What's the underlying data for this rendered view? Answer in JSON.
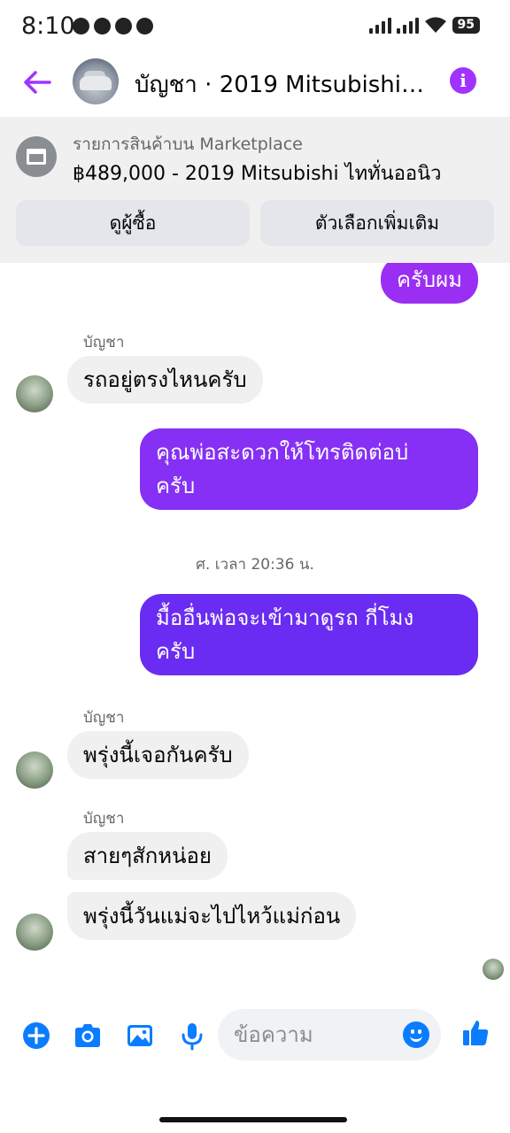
{
  "status_bar": {
    "time": "8:10",
    "battery": "95"
  },
  "header": {
    "title": "บัญชา · 2019 Mitsubishi…"
  },
  "marketplace": {
    "subtitle": "รายการสินค้าบน Marketplace",
    "listing": "฿489,000 - 2019 Mitsubishi ไททั่นออนิว",
    "view_buyer": "ดูผู้ซื้อ",
    "more_options": "ตัวเลือกเพิ่มเติม"
  },
  "messages": [
    {
      "direction": "out",
      "text": "ครับผม"
    },
    {
      "direction": "in",
      "sender": "บัญชา",
      "text": "รถอยู่ตรงไหนครับ"
    },
    {
      "direction": "out",
      "text": "คุณพ่อสะดวกให้โทรติดต่อบ่\nครับ"
    },
    {
      "type": "timestamp",
      "text": "ศ. เวลา 20:36 น."
    },
    {
      "direction": "out",
      "text": "มื้ออื่นพ่อจะเข้ามาดูรถ กี่โมง\nครับ"
    },
    {
      "direction": "in",
      "sender": "บัญชา",
      "text": "พรุ่งนี้เจอกันครับ"
    },
    {
      "direction": "in",
      "sender": "บัญชา",
      "text": "สายๆสักหน่อย"
    },
    {
      "direction": "in",
      "text": "พรุ่งนี้วันแม่จะไปไหว้แม่ก่อน"
    }
  ],
  "composer": {
    "placeholder": "ข้อความ"
  },
  "colors": {
    "accent": "#a033ff",
    "bubble_purple": "#8b2df5",
    "bubble_indigo": "#6a2cf2",
    "messenger_blue": "#0a7cff"
  }
}
